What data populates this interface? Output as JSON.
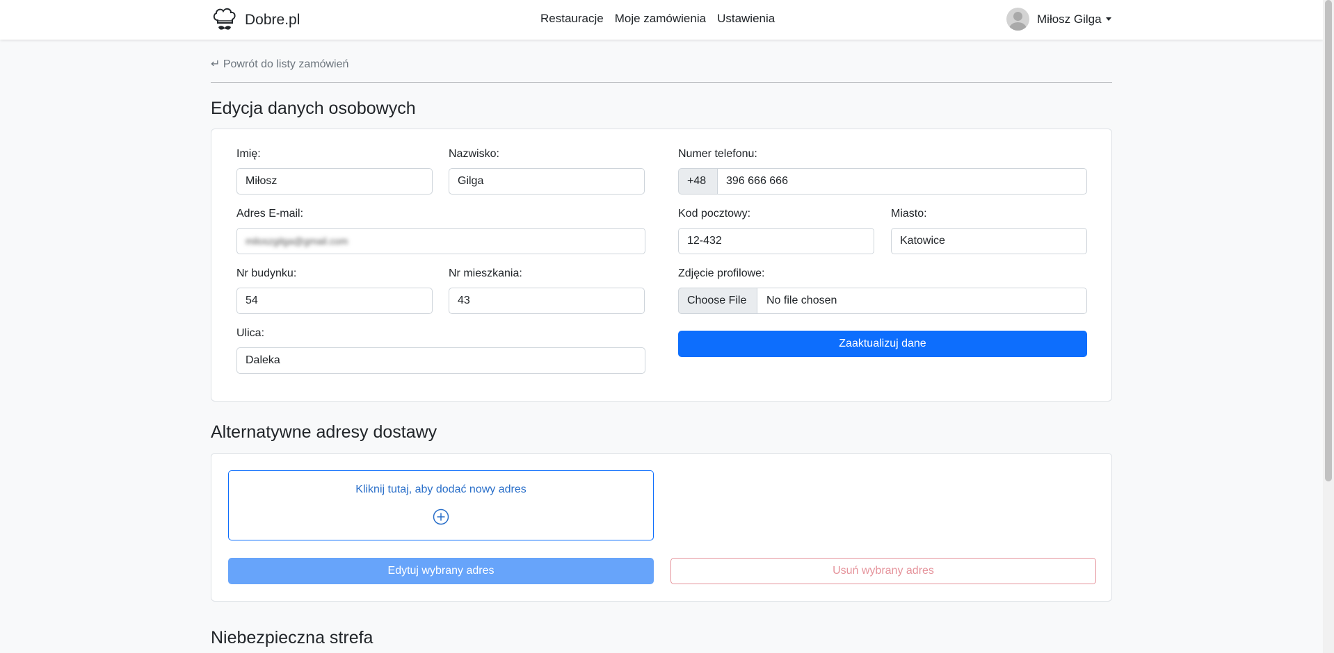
{
  "brand": {
    "name": "Dobre.pl",
    "icon": "chef-hat-mustache-icon"
  },
  "nav": {
    "links": [
      "Restauracje",
      "Moje zamówienia",
      "Ustawienia"
    ]
  },
  "user": {
    "name": "Miłosz Gilga",
    "avatar_icon": "user-avatar-icon"
  },
  "back_link": "↵ Powrót do listy zamówień",
  "personal": {
    "title": "Edycja danych osobowych",
    "first_name_label": "Imię:",
    "first_name": "Miłosz",
    "last_name_label": "Nazwisko:",
    "last_name": "Gilga",
    "email_label": "Adres E-mail:",
    "email": "miloszgilga@gmail.com",
    "building_label": "Nr budynku:",
    "building": "54",
    "apartment_label": "Nr mieszkania:",
    "apartment": "43",
    "street_label": "Ulica:",
    "street": "Daleka",
    "phone_label": "Numer telefonu:",
    "phone_prefix": "+48",
    "phone": "396 666 666",
    "postal_label": "Kod pocztowy:",
    "postal": "12-432",
    "city_label": "Miasto:",
    "city": "Katowice",
    "photo_label": "Zdjęcie profilowe:",
    "file_button": "Choose File",
    "file_status": "No file chosen",
    "submit": "Zaaktualizuj dane"
  },
  "addresses": {
    "title": "Alternatywne adresy dostawy",
    "add_text": "Kliknij tutaj, aby dodać nowy adres",
    "edit_button": "Edytuj wybrany adres",
    "delete_button": "Usuń wybrany adres"
  },
  "danger": {
    "title": "Niebezpieczna strefa"
  },
  "colors": {
    "primary": "#0d6efd",
    "primary_disabled": "#67a4fa",
    "danger_disabled": "#e5939b",
    "background": "#f8f9fa"
  }
}
